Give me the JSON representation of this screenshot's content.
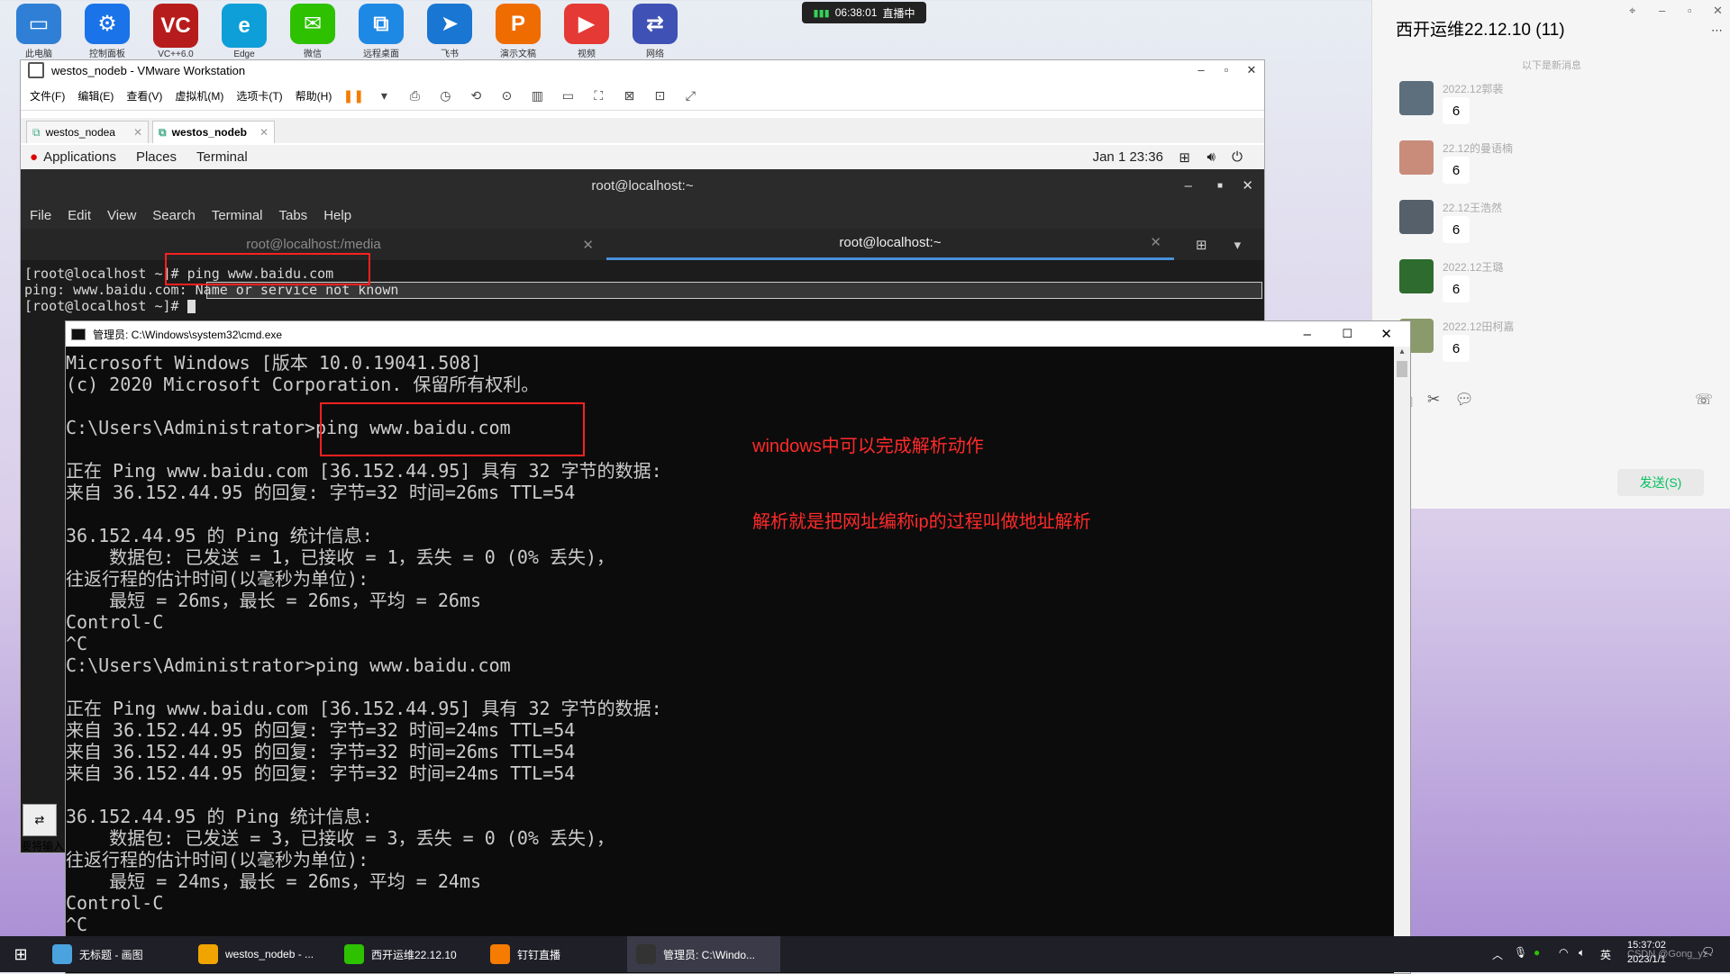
{
  "desktop": {
    "icons": [
      {
        "name": "computer",
        "label": "此电脑",
        "color": "#2f7fd6",
        "glyph": "▭"
      },
      {
        "name": "settings",
        "label": "控制面板",
        "color": "#1a73e8",
        "glyph": "⚙"
      },
      {
        "name": "vc",
        "label": "VC++6.0",
        "color": "#b71c1c",
        "glyph": "VC"
      },
      {
        "name": "edge",
        "label": "Edge",
        "color": "#0f9fd8",
        "glyph": "e"
      },
      {
        "name": "wechat",
        "label": "微信",
        "color": "#2dc100",
        "glyph": "✉"
      },
      {
        "name": "remote",
        "label": "远程桌面",
        "color": "#1e88e5",
        "glyph": "⧉"
      },
      {
        "name": "feishu",
        "label": "飞书",
        "color": "#1976d2",
        "glyph": "➤"
      },
      {
        "name": "ppt",
        "label": "演示文稿",
        "color": "#ef6c00",
        "glyph": "P"
      },
      {
        "name": "video",
        "label": "视频",
        "color": "#e53935",
        "glyph": "▶"
      },
      {
        "name": "net",
        "label": "网络",
        "color": "#3f51b5",
        "glyph": "⇄"
      }
    ]
  },
  "live_badge": {
    "signal": "▮▮▮",
    "time": "06:38:01",
    "status": "直播中"
  },
  "vmware": {
    "title": "westos_nodeb - VMware Workstation",
    "menu": [
      "文件(F)",
      "编辑(E)",
      "查看(V)",
      "虚拟机(M)",
      "选项卡(T)",
      "帮助(H)"
    ],
    "tabs": [
      {
        "label": "westos_nodea"
      },
      {
        "label": "westos_nodeb"
      }
    ],
    "side_label": "要将输入"
  },
  "gnome": {
    "applications": "Applications",
    "places": "Places",
    "terminal": "Terminal",
    "clock": "Jan 1  23:36"
  },
  "terminal": {
    "title": "root@localhost:~",
    "menu": [
      "File",
      "Edit",
      "View",
      "Search",
      "Terminal",
      "Tabs",
      "Help"
    ],
    "tabs": [
      "root@localhost:/media",
      "root@localhost:~"
    ],
    "lines": [
      "[root@localhost ~]# ping www.baidu.com",
      "ping: www.baidu.com: Name or service not known",
      "[root@localhost ~]# "
    ]
  },
  "cmd": {
    "title": "管理员: C:\\Windows\\system32\\cmd.exe",
    "lines": [
      "Microsoft Windows [版本 10.0.19041.508]",
      "(c) 2020 Microsoft Corporation. 保留所有权利。",
      "",
      "C:\\Users\\Administrator>ping www.baidu.com",
      "",
      "正在 Ping www.baidu.com [36.152.44.95] 具有 32 字节的数据:",
      "来自 36.152.44.95 的回复: 字节=32 时间=26ms TTL=54",
      "",
      "36.152.44.95 的 Ping 统计信息:",
      "    数据包: 已发送 = 1，已接收 = 1，丢失 = 0 (0% 丢失)，",
      "往返行程的估计时间(以毫秒为单位):",
      "    最短 = 26ms，最长 = 26ms，平均 = 26ms",
      "Control-C",
      "^C",
      "C:\\Users\\Administrator>ping www.baidu.com",
      "",
      "正在 Ping www.baidu.com [36.152.44.95] 具有 32 字节的数据:",
      "来自 36.152.44.95 的回复: 字节=32 时间=24ms TTL=54",
      "来自 36.152.44.95 的回复: 字节=32 时间=26ms TTL=54",
      "来自 36.152.44.95 的回复: 字节=32 时间=24ms TTL=54",
      "",
      "36.152.44.95 的 Ping 统计信息:",
      "    数据包: 已发送 = 3，已接收 = 3，丢失 = 0 (0% 丢失)，",
      "往返行程的估计时间(以毫秒为单位):",
      "    最短 = 24ms，最长 = 26ms，平均 = 24ms",
      "Control-C",
      "^C"
    ]
  },
  "annotations": {
    "a1": "windows中可以完成解析动作",
    "a2": "解析就是把网址编称ip的过程叫做地址解析"
  },
  "chat": {
    "title": "西开运维22.12.10 (11)",
    "divider": "以下是新消息",
    "messages": [
      {
        "name": "2022.12郭裴",
        "text": "6",
        "color": "#5d6f7d"
      },
      {
        "name": "22.12的曼语楠",
        "text": "6",
        "color": "#c98b7a"
      },
      {
        "name": "22.12王浩然",
        "text": "6",
        "color": "#55606a"
      },
      {
        "name": "2022.12王璐",
        "text": "6",
        "color": "#2e6b2e"
      },
      {
        "name": "2022.12田柯嘉",
        "text": "6",
        "color": "#8a9a6a"
      }
    ],
    "send": "发送(S)"
  },
  "taskbar": {
    "items": [
      {
        "label": "无标题 - 画图",
        "color": "#4aa3df"
      },
      {
        "label": "westos_nodeb - ...",
        "color": "#f0a400"
      },
      {
        "label": "西开运维22.12.10",
        "color": "#2dc100"
      },
      {
        "label": "钉钉直播",
        "color": "#f57c00"
      },
      {
        "label": "管理员: C:\\Windo...",
        "color": "#333"
      }
    ],
    "ime": "英",
    "time": "15:37:02",
    "date": "2023/1/1",
    "watermark": "CSDN @Gong_yz"
  }
}
